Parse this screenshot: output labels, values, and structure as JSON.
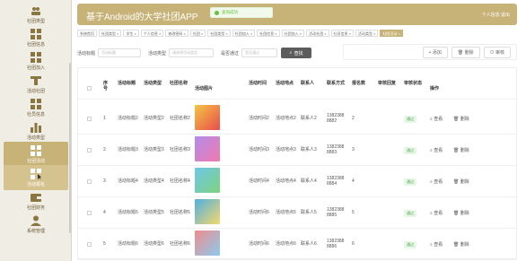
{
  "sidebar": {
    "items": [
      {
        "label": "社团类型",
        "icon": "users-icon"
      },
      {
        "label": "社团信息",
        "icon": "grid-icon"
      },
      {
        "label": "社团加入",
        "icon": "grid-icon"
      },
      {
        "label": "活动社团",
        "icon": "podium-icon"
      },
      {
        "label": "社员信息",
        "icon": "grid-icon"
      },
      {
        "label": "活动类型",
        "icon": "bar-chart-icon"
      },
      {
        "label": "社团活动",
        "icon": "grid-icon"
      },
      {
        "label": "活动报名",
        "icon": "grid-icon"
      },
      {
        "label": "社团财务",
        "icon": "wallet-icon"
      },
      {
        "label": "系统管理",
        "icon": "user-icon"
      }
    ]
  },
  "header": {
    "title": "基于Android的大学社团APP",
    "user_text": "个人信息  退出"
  },
  "toast": {
    "text": "查询成功"
  },
  "tags": [
    "系统首页",
    "社团类型 ×",
    "学生 ×",
    "个人信息 ×",
    "修改密码 ×",
    "社团 ×",
    "社团类型 ×",
    "社团加入 ×",
    "社团信息 ×",
    "社团加入 ×",
    "活动社团 ×",
    "社员信息 ×",
    "活动类型 ×",
    "社团活动 ×"
  ],
  "search": {
    "title_label": "活动标题",
    "title_placeholder": "活动标题",
    "type_label": "活动类型",
    "type_placeholder": "请选择活动类型",
    "pass_label": "是否通过",
    "pass_placeholder": "是否通过",
    "button": "查找"
  },
  "actions": {
    "add": "添加",
    "delete": "删除",
    "review": "审核"
  },
  "table": {
    "headers": [
      "序号",
      "活动标题",
      "活动类型",
      "社团名称",
      "活动图片",
      "活动时间",
      "活动地点",
      "联系人",
      "联系方式",
      "报名数",
      "审核回复",
      "审核状态",
      "操作"
    ],
    "rows": [
      {
        "no": "1",
        "title": "活动标题2",
        "type": "活动类型2",
        "club": "社团名称2",
        "time": "活动时间2",
        "place": "活动地点2",
        "contact": "联系人2",
        "phone": "13823888882",
        "count": "2",
        "status": "通过",
        "view": "查看",
        "del": "删除"
      },
      {
        "no": "2",
        "title": "活动标题3",
        "type": "活动类型3",
        "club": "社团名称3",
        "time": "活动时间3",
        "place": "活动地点3",
        "contact": "联系人3",
        "phone": "13823888883",
        "count": "3",
        "status": "通过",
        "view": "查看",
        "del": "删除"
      },
      {
        "no": "3",
        "title": "活动标题4",
        "type": "活动类型4",
        "club": "社团名称4",
        "time": "活动时间4",
        "place": "活动地点4",
        "contact": "联系人4",
        "phone": "13823888884",
        "count": "4",
        "status": "通过",
        "view": "查看",
        "del": "删除"
      },
      {
        "no": "4",
        "title": "活动标题5",
        "type": "活动类型5",
        "club": "社团名称5",
        "time": "活动时间5",
        "place": "活动地点5",
        "contact": "联系人5",
        "phone": "13823888885",
        "count": "5",
        "status": "通过",
        "view": "查看",
        "del": "删除"
      },
      {
        "no": "5",
        "title": "活动标题6",
        "type": "活动类型6",
        "club": "社团名称6",
        "time": "活动时间6",
        "place": "活动地点6",
        "contact": "联系人6",
        "phone": "13823888886",
        "count": "6",
        "status": "通过",
        "view": "查看",
        "del": "删除"
      }
    ]
  },
  "colors": {
    "accent": "#c7b277",
    "sidebar_bg": "#f0ede4"
  }
}
